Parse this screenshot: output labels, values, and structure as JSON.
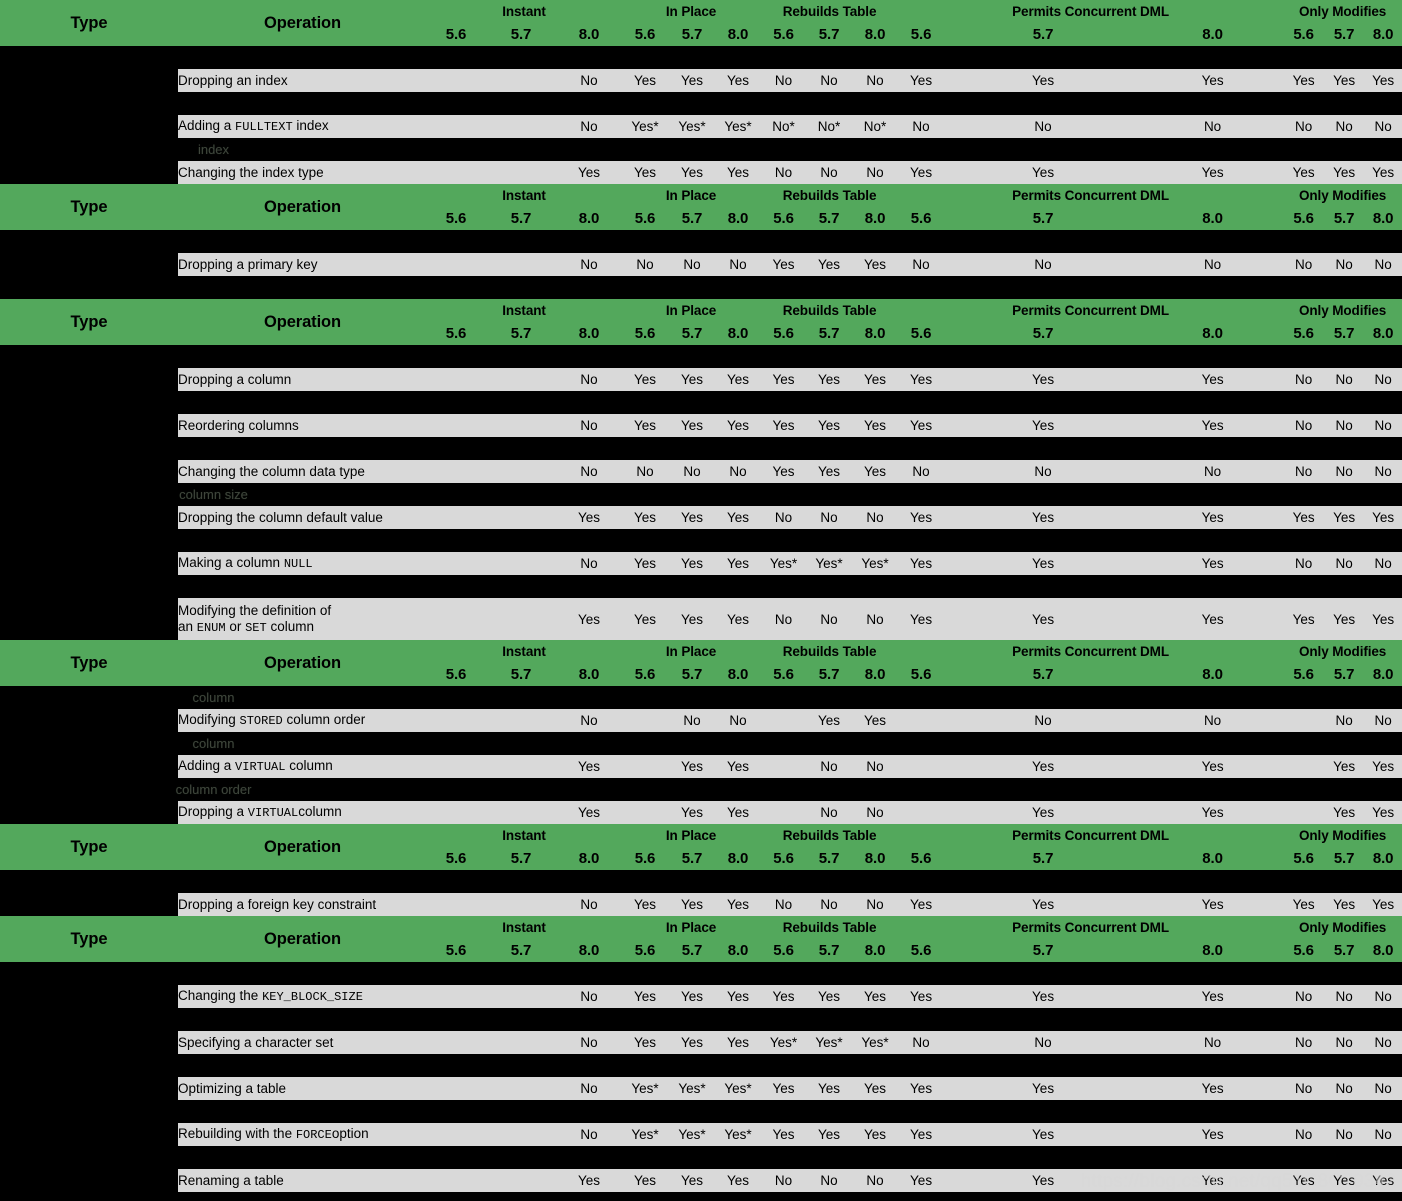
{
  "header": {
    "type_label": "Type",
    "operation_label": "Operation",
    "groups": [
      {
        "title": "Instant",
        "versions": [
          "5.6",
          "5.7",
          "8.0"
        ]
      },
      {
        "title": "In Place",
        "versions": [
          "5.6",
          "5.7",
          "8.0"
        ]
      },
      {
        "title": "Rebuilds Table",
        "versions": [
          "5.6",
          "5.7",
          "8.0"
        ]
      },
      {
        "title": "Permits Concurrent DML",
        "versions": [
          "5.6",
          "5.7",
          "8.0"
        ]
      },
      {
        "title": "Only Modifies",
        "versions": [
          "5.6",
          "5.7",
          "8.0"
        ]
      }
    ]
  },
  "colors": {
    "header_green": "#53a85c",
    "cell_grey": "#d9d9d9",
    "background": "#000000",
    "text": "#000000"
  },
  "ghost_labels": {
    "index": "index",
    "column_size": "column size",
    "column": "column",
    "column_order": "column order"
  },
  "rows": [
    {
      "op_pre": "Dropping an index",
      "op_code": "",
      "op_post": "",
      "op_line2": "",
      "values": [
        "",
        "",
        "No",
        "Yes",
        "Yes",
        "Yes",
        "No",
        "No",
        "No",
        "Yes",
        "Yes",
        "Yes",
        "Yes",
        "Yes",
        "Yes"
      ]
    },
    {
      "op_pre": "Adding a ",
      "op_code": "FULLTEXT",
      "op_post": " index",
      "op_line2": "",
      "values": [
        "",
        "",
        "No",
        "Yes*",
        "Yes*",
        "Yes*",
        "No*",
        "No*",
        "No*",
        "No",
        "No",
        "No",
        "No",
        "No",
        "No"
      ]
    },
    {
      "op_pre": "Changing the index type",
      "op_code": "",
      "op_post": "",
      "op_line2": "",
      "values": [
        "",
        "",
        "Yes",
        "Yes",
        "Yes",
        "Yes",
        "No",
        "No",
        "No",
        "Yes",
        "Yes",
        "Yes",
        "Yes",
        "Yes",
        "Yes"
      ]
    },
    {
      "op_pre": "Dropping a primary key",
      "op_code": "",
      "op_post": "",
      "op_line2": "",
      "values": [
        "",
        "",
        "No",
        "No",
        "No",
        "No",
        "Yes",
        "Yes",
        "Yes",
        "No",
        "No",
        "No",
        "No",
        "No",
        "No"
      ]
    },
    {
      "op_pre": "Dropping a column",
      "op_code": "",
      "op_post": "",
      "op_line2": "",
      "values": [
        "",
        "",
        "No",
        "Yes",
        "Yes",
        "Yes",
        "Yes",
        "Yes",
        "Yes",
        "Yes",
        "Yes",
        "Yes",
        "No",
        "No",
        "No"
      ]
    },
    {
      "op_pre": "Reordering columns",
      "op_code": "",
      "op_post": "",
      "op_line2": "",
      "values": [
        "",
        "",
        "No",
        "Yes",
        "Yes",
        "Yes",
        "Yes",
        "Yes",
        "Yes",
        "Yes",
        "Yes",
        "Yes",
        "No",
        "No",
        "No"
      ]
    },
    {
      "op_pre": "Changing the column data type",
      "op_code": "",
      "op_post": "",
      "op_line2": "",
      "values": [
        "",
        "",
        "No",
        "No",
        "No",
        "No",
        "Yes",
        "Yes",
        "Yes",
        "No",
        "No",
        "No",
        "No",
        "No",
        "No"
      ]
    },
    {
      "op_pre": "Dropping the column default value",
      "op_code": "",
      "op_post": "",
      "op_line2": "",
      "values": [
        "",
        "",
        "Yes",
        "Yes",
        "Yes",
        "Yes",
        "No",
        "No",
        "No",
        "Yes",
        "Yes",
        "Yes",
        "Yes",
        "Yes",
        "Yes"
      ]
    },
    {
      "op_pre": "Making a column ",
      "op_code": "NULL",
      "op_post": "",
      "op_line2": "",
      "values": [
        "",
        "",
        "No",
        "Yes",
        "Yes",
        "Yes",
        "Yes*",
        "Yes*",
        "Yes*",
        "Yes",
        "Yes",
        "Yes",
        "No",
        "No",
        "No"
      ]
    },
    {
      "op_pre": "Modifying the definition of",
      "op_code": "",
      "op_post": "",
      "op_line2": "an ENUM or SET column",
      "values": [
        "",
        "",
        "Yes",
        "Yes",
        "Yes",
        "Yes",
        "No",
        "No",
        "No",
        "Yes",
        "Yes",
        "Yes",
        "Yes",
        "Yes",
        "Yes"
      ]
    },
    {
      "op_pre": "Modifying ",
      "op_code": "STORED",
      "op_post": " column order",
      "op_line2": "",
      "values": [
        "",
        "",
        "No",
        "",
        "No",
        "No",
        "",
        "Yes",
        "Yes",
        "",
        "No",
        "No",
        "",
        "No",
        "No"
      ]
    },
    {
      "op_pre": "Adding a ",
      "op_code": "VIRTUAL",
      "op_post": " column",
      "op_line2": "",
      "values": [
        "",
        "",
        "Yes",
        "",
        "Yes",
        "Yes",
        "",
        "No",
        "No",
        "",
        "Yes",
        "Yes",
        "",
        "Yes",
        "Yes"
      ]
    },
    {
      "op_pre": "Dropping a ",
      "op_code": "VIRTUAL",
      "op_post": "column",
      "op_line2": "",
      "values": [
        "",
        "",
        "Yes",
        "",
        "Yes",
        "Yes",
        "",
        "No",
        "No",
        "",
        "Yes",
        "Yes",
        "",
        "Yes",
        "Yes"
      ]
    },
    {
      "op_pre": "Dropping a foreign key constraint",
      "op_code": "",
      "op_post": "",
      "op_line2": "",
      "values": [
        "",
        "",
        "No",
        "Yes",
        "Yes",
        "Yes",
        "No",
        "No",
        "No",
        "Yes",
        "Yes",
        "Yes",
        "Yes",
        "Yes",
        "Yes"
      ]
    },
    {
      "op_pre": "Changing the ",
      "op_code": "KEY_BLOCK_SIZE",
      "op_post": "",
      "op_line2": "",
      "values": [
        "",
        "",
        "No",
        "Yes",
        "Yes",
        "Yes",
        "Yes",
        "Yes",
        "Yes",
        "Yes",
        "Yes",
        "Yes",
        "No",
        "No",
        "No"
      ]
    },
    {
      "op_pre": "Specifying a character set",
      "op_code": "",
      "op_post": "",
      "op_line2": "",
      "values": [
        "",
        "",
        "No",
        "Yes",
        "Yes",
        "Yes",
        "Yes*",
        "Yes*",
        "Yes*",
        "No",
        "No",
        "No",
        "No",
        "No",
        "No"
      ]
    },
    {
      "op_pre": "Optimizing a table",
      "op_code": "",
      "op_post": "",
      "op_line2": "",
      "values": [
        "",
        "",
        "No",
        "Yes*",
        "Yes*",
        "Yes*",
        "Yes",
        "Yes",
        "Yes",
        "Yes",
        "Yes",
        "Yes",
        "No",
        "No",
        "No"
      ]
    },
    {
      "op_pre": "Rebuilding with the ",
      "op_code": "FORCE",
      "op_post": "option",
      "op_line2": "",
      "values": [
        "",
        "",
        "No",
        "Yes*",
        "Yes*",
        "Yes*",
        "Yes",
        "Yes",
        "Yes",
        "Yes",
        "Yes",
        "Yes",
        "No",
        "No",
        "No"
      ]
    },
    {
      "op_pre": "Renaming a table",
      "op_code": "",
      "op_post": "",
      "op_line2": "",
      "values": [
        "",
        "",
        "Yes",
        "Yes",
        "Yes",
        "Yes",
        "No",
        "No",
        "No",
        "Yes",
        "Yes",
        "Yes",
        "Yes",
        "Yes",
        "Yes"
      ]
    }
  ],
  "watermark": "https://blog.csdn.net/qq51C8C70342"
}
